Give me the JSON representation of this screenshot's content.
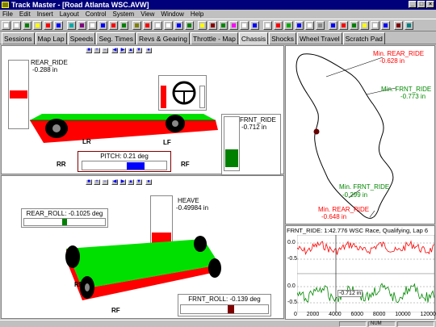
{
  "window": {
    "title": "Track Master - [Road Atlanta WSC.AVW]",
    "buttons": [
      "_",
      "□",
      "×"
    ]
  },
  "menu": [
    "File",
    "Edit",
    "Insert",
    "Layout",
    "Control",
    "System",
    "View",
    "Window",
    "Help"
  ],
  "tabs": [
    "Sessions",
    "Map Lap",
    "Speeds",
    "Seg. Times",
    "Revs & Gearing",
    "Throttle - Map",
    "Chassis",
    "Shocks",
    "Wheel Travel",
    "Scratch Pad"
  ],
  "active_tab": "Chassis",
  "upper_view": {
    "rear_ride": {
      "label": "REAR_RIDE",
      "value": "-0.288 in",
      "level": 0.5
    },
    "front_ride": {
      "label": "FRNT_RIDE",
      "value": "-0.712 in",
      "level": 0.4
    },
    "pitch": {
      "label": "PITCH",
      "value": "0.21 deg",
      "level": 0.55
    },
    "wheel_labels": {
      "lr": "LR",
      "lf": "LF",
      "rr": "RR",
      "rf": "RF"
    }
  },
  "lower_view": {
    "heave": {
      "label": "HEAVE",
      "value": "-0.49984 in",
      "level": 0.35
    },
    "rear_roll": {
      "label": "REAR_ROLL",
      "value": "-0.1025 deg",
      "level": 0.5
    },
    "front_roll": {
      "label": "FRNT_ROLL",
      "value": "-0.139 deg",
      "level": 0.48
    },
    "wheel_labels": {
      "rr": "RR",
      "rf": "RF"
    }
  },
  "track_map": {
    "annotations": [
      {
        "name": "Min. REAR_RIDE",
        "value": "-0.628 in"
      },
      {
        "name": "Min. FRNT_RIDE",
        "value": "-0.773 in"
      },
      {
        "name": "Min. FRNT_RIDE",
        "value": "-0.299 in"
      },
      {
        "name": "Min. REAR_RIDE",
        "value": "-0.648 in"
      }
    ]
  },
  "trace": {
    "title": "FRNT_RIDE: 1:42.776 WSC Race, Qualifying, Lap 6",
    "cursor_value": "-0.712 in",
    "x_ticks": [
      "0",
      "2000",
      "4000",
      "6000",
      "8000",
      "10000",
      "12000"
    ],
    "upper_y_ticks": [
      "0.0",
      "-0.5"
    ],
    "lower_y_ticks": [
      "0.0",
      "-0.5"
    ]
  },
  "status": {
    "num": "NUM"
  },
  "colors": {
    "red": "#ff0000",
    "green": "#00a000",
    "blue": "#0000ff",
    "title_bar": "#00007b",
    "maroon": "#800000"
  }
}
